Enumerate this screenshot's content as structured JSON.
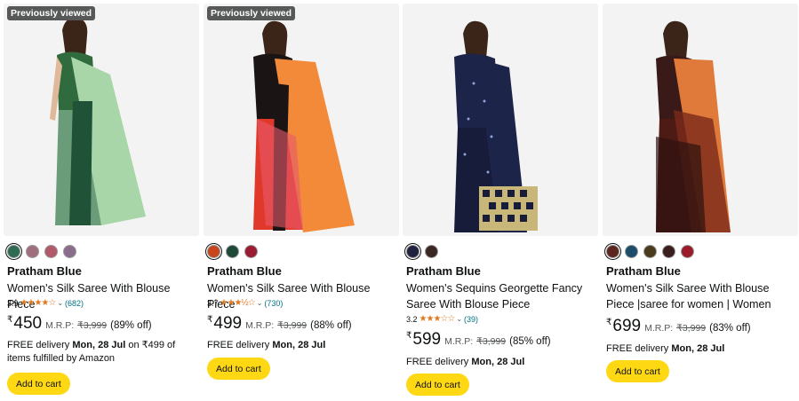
{
  "products": [
    {
      "badge": "Previously viewed",
      "brand": "Pratham Blue",
      "title": "Women's Silk Saree With Blouse Piece",
      "rating": "3.9",
      "stars": "★★★★☆",
      "reviews": "(682)",
      "currency": "₹",
      "price": "450",
      "mrp_label": "M.R.P:",
      "mrp": "₹3,999",
      "discount": "(89% off)",
      "delivery_prefix": "FREE delivery ",
      "delivery_date": "Mon, 28 Jul",
      "delivery_suffix": " on ₹499 of items fulfilled by Amazon",
      "button": "Add to cart",
      "swatches": [
        "#2f6b50",
        "#a06f7d",
        "#b05a6a",
        "#8a6c8c"
      ]
    },
    {
      "badge": "Previously viewed",
      "brand": "Pratham Blue",
      "title": "Women's Silk Saree With Blouse Piece",
      "rating": "3.7",
      "stars": "★★★½☆",
      "reviews": "(730)",
      "currency": "₹",
      "price": "499",
      "mrp_label": "M.R.P:",
      "mrp": "₹3,999",
      "discount": "(88% off)",
      "delivery_prefix": "FREE delivery ",
      "delivery_date": "Mon, 28 Jul",
      "delivery_suffix": "",
      "button": "Add to cart",
      "swatches": [
        "#c8461e",
        "#1d4a36",
        "#9a1c34"
      ]
    },
    {
      "badge": "",
      "brand": "Pratham Blue",
      "title": "Women's Sequins Georgette Fancy Saree With Blouse Piece",
      "rating": "3.2",
      "stars": "★★★☆☆",
      "reviews": "(39)",
      "currency": "₹",
      "price": "599",
      "mrp_label": "M.R.P:",
      "mrp": "₹3,999",
      "discount": "(85% off)",
      "delivery_prefix": "FREE delivery ",
      "delivery_date": "Mon, 28 Jul",
      "delivery_suffix": "",
      "button": "Add to cart",
      "swatches": [
        "#1f2340",
        "#3a2622"
      ]
    },
    {
      "badge": "",
      "brand": "Pratham Blue",
      "title": "Women's Silk Saree With Blouse Piece |saree for women | Women saree wit...",
      "rating": "",
      "stars": "",
      "reviews": "",
      "currency": "₹",
      "price": "699",
      "mrp_label": "M.R.P:",
      "mrp": "₹3,999",
      "discount": "(83% off)",
      "delivery_prefix": "FREE delivery ",
      "delivery_date": "Mon, 28 Jul",
      "delivery_suffix": "",
      "button": "Add to cart",
      "swatches": [
        "#5c2520",
        "#1e4d6b",
        "#4a3b1c",
        "#3b1e1e",
        "#9a1c2a"
      ]
    }
  ]
}
